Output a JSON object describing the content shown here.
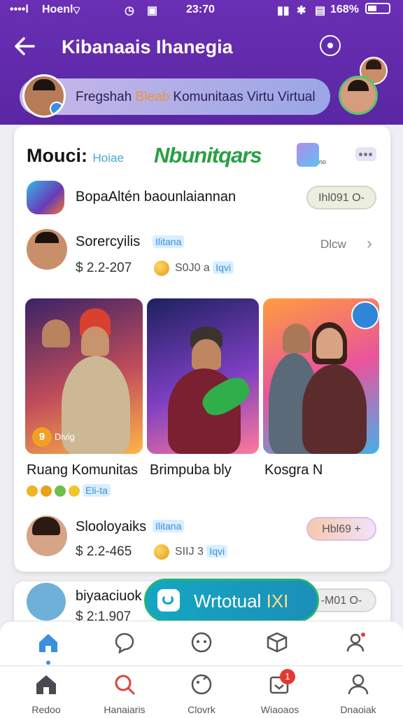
{
  "status_bar": {
    "carrier": "Hoenl",
    "time": "23:70",
    "battery": "168%"
  },
  "header": {
    "title": "Kibanaais Ihanegia",
    "back_icon": "arrow-left-icon",
    "action_icon": "circle-dot-icon"
  },
  "community_pill": {
    "text_before": "Fregshah ",
    "text_accent": "Bleab",
    "text_after": " Komunitaas Virtu Virtual"
  },
  "brand": {
    "left_name": "Mouci:",
    "left_sub": "Hoiae",
    "center_name": "Nbunitqars",
    "app_icon_label": "no"
  },
  "rows": [
    {
      "title": "BopaAltén baounlaiannan",
      "chip": "Ihl091 O-"
    },
    {
      "name": "Sorercyilis",
      "badge": "Ilitana",
      "price": "$ 2.2-207",
      "coin_text": "S0J0 a",
      "coin_tag": "Iqvi",
      "right_text": "Dlcw"
    },
    {
      "name": "Slooloyaiks",
      "badge": "Ilitana",
      "price": "$ 2.2-465",
      "coin_text": "SIIJ 3",
      "coin_tag": "Iqvi",
      "chip": "Hbl69 +"
    },
    {
      "name": "biyaaciuok",
      "price": "$ 2:1.907",
      "chip": "-M01 O-"
    }
  ],
  "tiles": [
    {
      "label": "Ruang Komunitas",
      "badge": "9",
      "badge_text": "Divig"
    },
    {
      "label": "Brimpuba bly"
    },
    {
      "label": "Kosgra N"
    }
  ],
  "tile_tag": "Eli-ta",
  "fab": {
    "label": "Wrtotual",
    "suffix": "IXI"
  },
  "nav_top_icons": [
    "home-icon",
    "chat-bubble-icon",
    "smiley-icon",
    "box-icon",
    "profile-icon"
  ],
  "nav_bottom": [
    {
      "label": "Redoo",
      "icon": "home-icon"
    },
    {
      "label": "Hanaiaris",
      "icon": "search-icon"
    },
    {
      "label": "Clovrk",
      "icon": "face-icon"
    },
    {
      "label": "Wiaoaos",
      "icon": "inbox-icon",
      "badge": "1"
    },
    {
      "label": "Dnaoiak",
      "icon": "user-icon"
    }
  ],
  "colors": {
    "header": "#5e28a8",
    "accent_green": "#27a043",
    "fab": "#1798bd"
  }
}
